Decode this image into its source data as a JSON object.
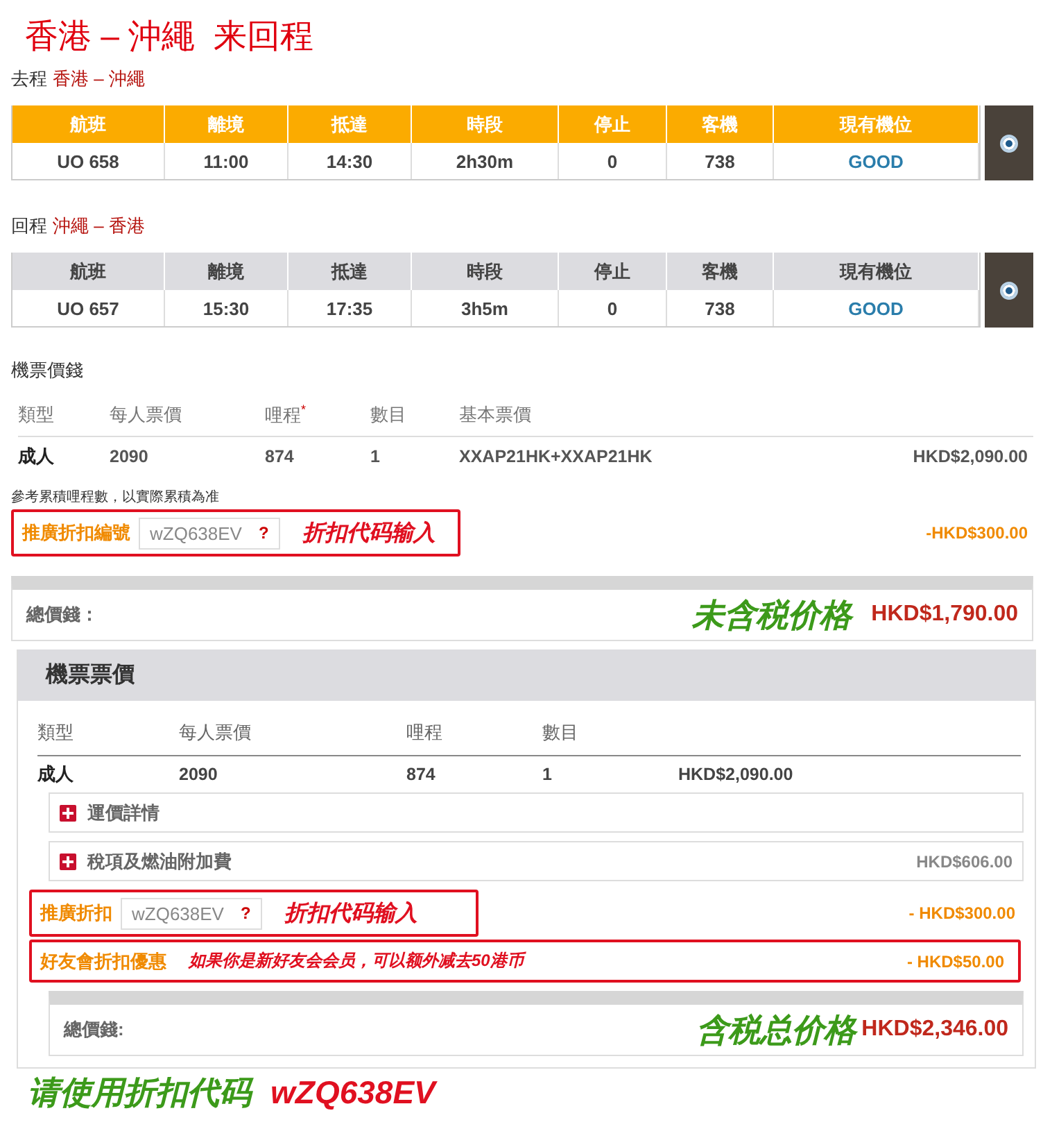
{
  "title": "香港 – 沖繩  来回程",
  "flights": [
    {
      "direction": "去程",
      "route": "香港 – 沖繩",
      "selected": true,
      "columns": [
        "航班",
        "離境",
        "抵達",
        "時段",
        "停止",
        "客機",
        "現有機位"
      ],
      "row": [
        "UO 658",
        "11:00",
        "14:30",
        "2h30m",
        "0",
        "738",
        "GOOD"
      ],
      "chosen": true
    },
    {
      "direction": "回程",
      "route": "沖繩 – 香港",
      "selected": false,
      "columns": [
        "航班",
        "離境",
        "抵達",
        "時段",
        "停止",
        "客機",
        "現有機位"
      ],
      "row": [
        "UO 657",
        "15:30",
        "17:35",
        "3h5m",
        "0",
        "738",
        "GOOD"
      ],
      "chosen": true
    }
  ],
  "fare": {
    "heading": "機票價錢",
    "columns": [
      "類型",
      "每人票價",
      "哩程",
      "數目",
      "基本票價"
    ],
    "required_mark": "*",
    "row": [
      "成人",
      "2090",
      "874",
      "1",
      "XXAP21HK+XXAP21HK",
      "HKD$2,090.00"
    ],
    "note": "參考累積哩程數，以實際累積為准",
    "promo": {
      "label": "推廣折扣編號",
      "code": "wZQ638EV",
      "help": "?",
      "annotation": "折扣代码输入",
      "amount": "-HKD$300.00"
    },
    "total": {
      "label": "總價錢：",
      "annotation": "未含税价格",
      "amount": "HKD$1,790.00"
    }
  },
  "breakdown": {
    "heading": "機票票價",
    "columns": [
      "類型",
      "每人票價",
      "哩程",
      "數目"
    ],
    "row": [
      "成人",
      "2090",
      "874",
      "1",
      "HKD$2,090.00"
    ],
    "details": [
      {
        "label": "運價詳情",
        "expanded": false
      },
      {
        "label": "稅項及燃油附加費",
        "expanded": false,
        "amount": "HKD$606.00"
      }
    ],
    "promo": {
      "label": "推廣折扣",
      "code": "wZQ638EV",
      "help": "?",
      "annotation": "折扣代码输入",
      "amount": "- HKD$300.00"
    },
    "member": {
      "label": "好友會折扣優惠",
      "annotation": "如果你是新好友会会员，可以额外减去50港币",
      "amount": "- HKD$50.00"
    },
    "total": {
      "label": "總價錢:",
      "annotation": "含税总价格",
      "amount": "HKD$2,346.00"
    }
  },
  "footer": {
    "text": "请使用折扣代码",
    "code": "wZQ638EV"
  }
}
